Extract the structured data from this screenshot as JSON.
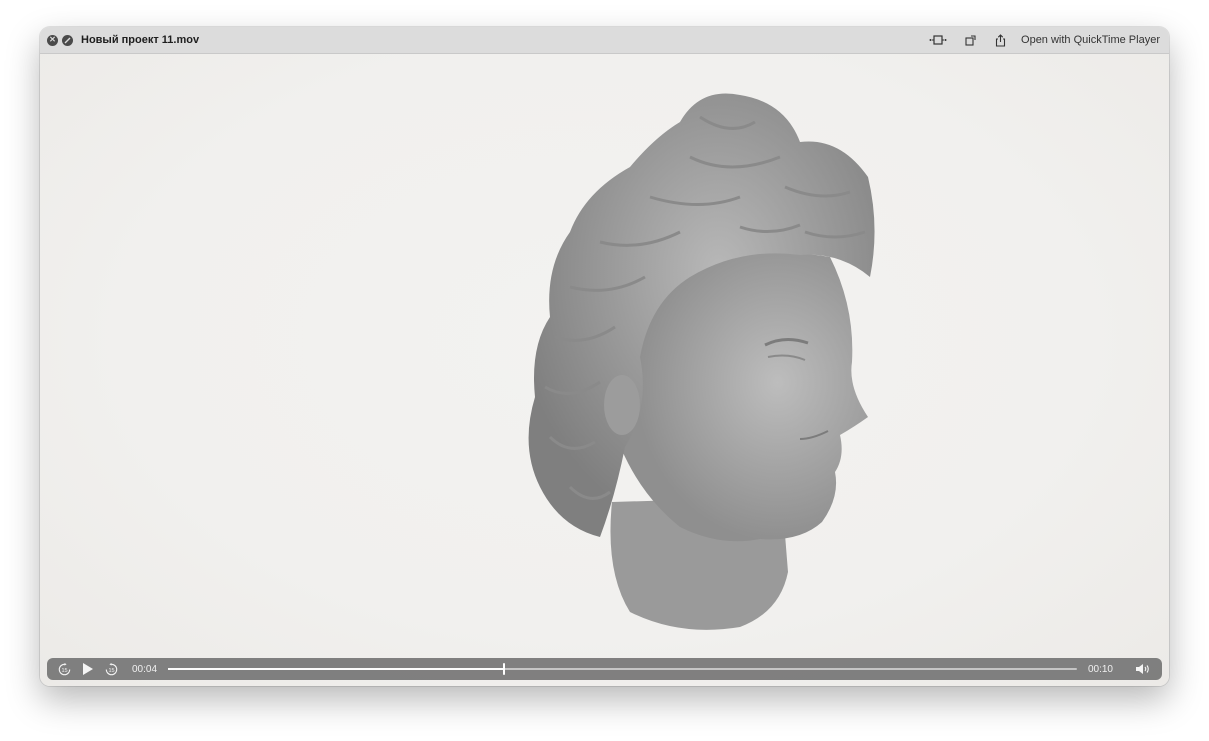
{
  "window": {
    "title": "Новый проект 11.mov",
    "open_button_label": "Open with QuickTime Player"
  },
  "titlebar_icons": {
    "close": "close-icon",
    "fullscreen": "fullscreen-icon",
    "trim": "trim-icon",
    "rotate": "rotate-icon",
    "share": "share-icon"
  },
  "player": {
    "current_time": "00:04",
    "duration": "00:10",
    "progress_fraction": 0.37,
    "skip_back_seconds": "15",
    "skip_forward_seconds": "15",
    "state": "paused"
  },
  "colors": {
    "titlebar": "#dcdcdc",
    "video_background": "#f1f0ee",
    "controls_bar": "#707070"
  }
}
